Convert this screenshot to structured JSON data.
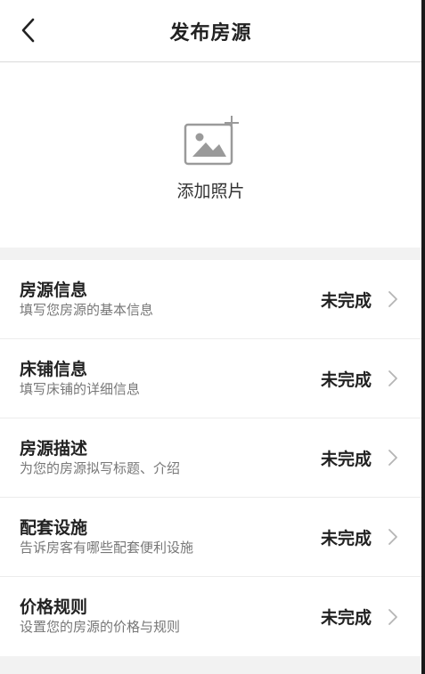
{
  "header": {
    "title": "发布房源"
  },
  "photo": {
    "label": "添加照片"
  },
  "rows": [
    {
      "title": "房源信息",
      "subtitle": "填写您房源的基本信息",
      "status": "未完成"
    },
    {
      "title": "床铺信息",
      "subtitle": "填写床铺的详细信息",
      "status": "未完成"
    },
    {
      "title": "房源描述",
      "subtitle": "为您的房源拟写标题、介绍",
      "status": "未完成"
    },
    {
      "title": "配套设施",
      "subtitle": "告诉房客有哪些配套便利设施",
      "status": "未完成"
    },
    {
      "title": "价格规则",
      "subtitle": "设置您的房源的价格与规则",
      "status": "未完成"
    }
  ],
  "icons": {
    "back": "chevron-left-icon",
    "add_photo": "add-photo-icon",
    "row_arrow": "chevron-right-icon"
  },
  "colors": {
    "background": "#ffffff",
    "section_gap": "#f2f2f2",
    "text_primary": "#222222",
    "text_secondary": "#777777",
    "arrow": "#b5b5b5"
  }
}
